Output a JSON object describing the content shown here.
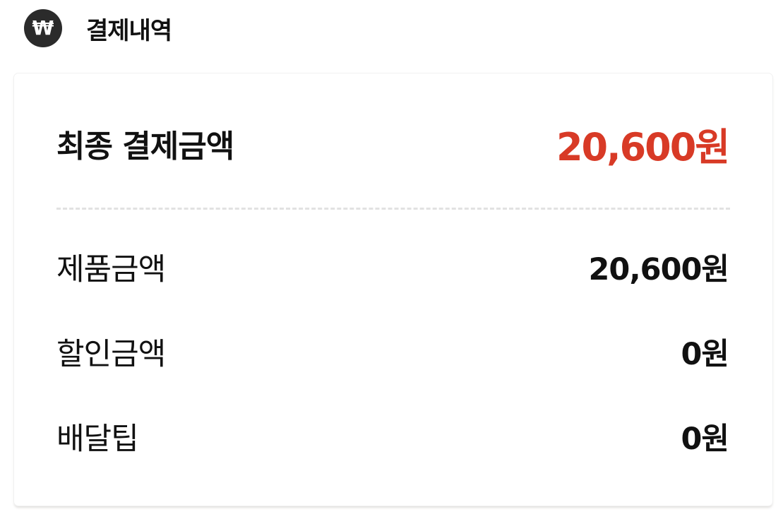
{
  "header": {
    "icon_glyph": "₩",
    "icon_name": "won-icon",
    "title": "결제내역"
  },
  "summary": {
    "total_label": "최종 결제금액",
    "total_value": "20,600원",
    "items": [
      {
        "label": "제품금액",
        "value": "20,600원"
      },
      {
        "label": "할인금액",
        "value": "0원"
      },
      {
        "label": "배달팁",
        "value": "0원"
      }
    ]
  },
  "colors": {
    "accent": "#d83a26",
    "text": "#111111",
    "icon_bg": "#2b2b2b",
    "divider": "#e2e2e2"
  }
}
